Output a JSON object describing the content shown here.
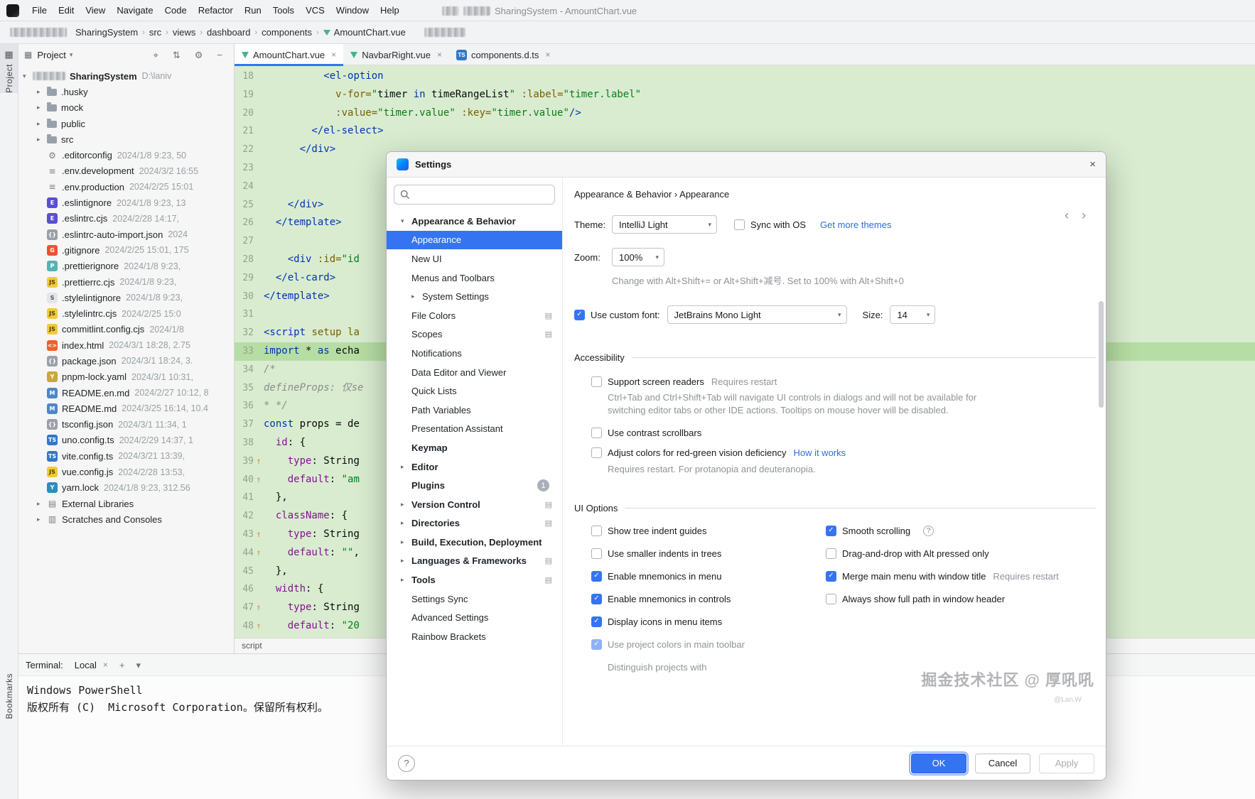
{
  "menubar": {
    "items": [
      "File",
      "Edit",
      "View",
      "Navigate",
      "Code",
      "Refactor",
      "Run",
      "Tools",
      "VCS",
      "Window",
      "Help"
    ],
    "window_title": "SharingSystem - AmountChart.vue"
  },
  "navbar": {
    "crumbs": [
      {
        "label": "SharingSystem",
        "sep": "›"
      },
      {
        "label": "src",
        "sep": "›"
      },
      {
        "label": "views",
        "sep": "›"
      },
      {
        "label": "dashboard",
        "sep": "›"
      },
      {
        "label": "components",
        "sep": "›"
      },
      {
        "label": "AmountChart.vue",
        "sep": "",
        "vue": true
      }
    ]
  },
  "stripe": {
    "project": "Project",
    "bookmarks": "Bookmarks"
  },
  "project": {
    "title": "Project",
    "root_name": "SharingSystem",
    "root_path": "D:\\laniv",
    "folders": [
      ".husky",
      "mock",
      "public",
      "src"
    ],
    "files": [
      {
        "name": ".editorconfig",
        "meta": "2024/1/8 9:23, 50",
        "icon": "⚙",
        "kind": "gear"
      },
      {
        "name": ".env.development",
        "meta": "2024/3/2 16:55",
        "icon": "≡",
        "kind": "env"
      },
      {
        "name": ".env.production",
        "meta": "2024/2/25 15:01",
        "icon": "≡",
        "kind": "env"
      },
      {
        "name": ".eslintignore",
        "meta": "2024/1/8 9:23, 13",
        "icon": "E",
        "kind": "eslint"
      },
      {
        "name": ".eslintrc.cjs",
        "meta": "2024/2/28 14:17,",
        "icon": "E",
        "kind": "eslint"
      },
      {
        "name": ".eslintrc-auto-import.json",
        "meta": "2024",
        "icon": "{}",
        "kind": "json"
      },
      {
        "name": ".gitignore",
        "meta": "2024/2/25 15:01, 175",
        "icon": "G",
        "kind": "git"
      },
      {
        "name": ".prettierignore",
        "meta": "2024/1/8 9:23,",
        "icon": "P",
        "kind": "pret"
      },
      {
        "name": ".prettierrc.cjs",
        "meta": "2024/1/8 9:23,",
        "icon": "JS",
        "kind": "js"
      },
      {
        "name": ".stylelintignore",
        "meta": "2024/1/8 9:23,",
        "icon": "S",
        "kind": "style"
      },
      {
        "name": ".stylelintrc.cjs",
        "meta": "2024/2/25 15:0",
        "icon": "JS",
        "kind": "js"
      },
      {
        "name": "commitlint.config.cjs",
        "meta": "2024/1/8",
        "icon": "JS",
        "kind": "js"
      },
      {
        "name": "index.html",
        "meta": "2024/3/1 18:28, 2.75",
        "icon": "<>",
        "kind": "html"
      },
      {
        "name": "package.json",
        "meta": "2024/3/1 18:24, 3.",
        "icon": "{}",
        "kind": "json"
      },
      {
        "name": "pnpm-lock.yaml",
        "meta": "2024/3/1 10:31,",
        "icon": "Y",
        "kind": "yaml"
      },
      {
        "name": "README.en.md",
        "meta": "2024/2/27 10:12, 8",
        "icon": "M",
        "kind": "md"
      },
      {
        "name": "README.md",
        "meta": "2024/3/25 16:14, 10.4",
        "icon": "M",
        "kind": "md"
      },
      {
        "name": "tsconfig.json",
        "meta": "2024/3/1 11:34, 1",
        "icon": "{}",
        "kind": "json"
      },
      {
        "name": "uno.config.ts",
        "meta": "2024/2/29 14:37, 1",
        "icon": "TS",
        "kind": "ts"
      },
      {
        "name": "vite.config.ts",
        "meta": "2024/3/21 13:39,",
        "icon": "TS",
        "kind": "ts"
      },
      {
        "name": "vue.config.js",
        "meta": "2024/2/28 13:53,",
        "icon": "JS",
        "kind": "js"
      },
      {
        "name": "yarn.lock",
        "meta": "2024/1/8 9:23, 312.56",
        "icon": "Y",
        "kind": "yarn"
      }
    ],
    "extras": [
      {
        "name": "External Libraries",
        "icon": "▤",
        "kind": "lib"
      },
      {
        "name": "Scratches and Consoles",
        "icon": "▥",
        "kind": "scratch"
      }
    ]
  },
  "editor": {
    "tabs": [
      {
        "label": "AmountChart.vue",
        "kind": "vue",
        "icon": "",
        "active": true
      },
      {
        "label": "NavbarRight.vue",
        "kind": "vue",
        "icon": ""
      },
      {
        "label": "components.d.ts",
        "kind": "ts",
        "icon": "TS"
      }
    ],
    "bottom_crumb": "script",
    "lines": [
      {
        "num": 18,
        "segs": [
          {
            "t": "          ",
            "c": "pl"
          },
          {
            "t": "<el-option",
            "c": "tag"
          }
        ]
      },
      {
        "num": 19,
        "segs": [
          {
            "t": "            ",
            "c": "pl"
          },
          {
            "t": "v-for=",
            "c": "dir"
          },
          {
            "t": "\"",
            "c": "str"
          },
          {
            "t": "timer ",
            "c": "var"
          },
          {
            "t": "in",
            "c": "kw"
          },
          {
            "t": " timeRangeList",
            "c": "var"
          },
          {
            "t": "\"",
            "c": "str"
          },
          {
            "t": " ",
            "c": "pl"
          },
          {
            "t": ":label=",
            "c": "dir"
          },
          {
            "t": "\"timer.label\"",
            "c": "str"
          }
        ]
      },
      {
        "num": 20,
        "segs": [
          {
            "t": "            ",
            "c": "pl"
          },
          {
            "t": ":value=",
            "c": "dir"
          },
          {
            "t": "\"timer.value\"",
            "c": "str"
          },
          {
            "t": " ",
            "c": "pl"
          },
          {
            "t": ":key=",
            "c": "dir"
          },
          {
            "t": "\"timer.value\"",
            "c": "str"
          },
          {
            "t": "/>",
            "c": "tag"
          }
        ]
      },
      {
        "num": 21,
        "segs": [
          {
            "t": "        ",
            "c": "pl"
          },
          {
            "t": "</el-select>",
            "c": "tag"
          }
        ]
      },
      {
        "num": 22,
        "segs": [
          {
            "t": "      ",
            "c": "pl"
          },
          {
            "t": "</div>",
            "c": "tag"
          }
        ]
      },
      {
        "num": 23,
        "segs": []
      },
      {
        "num": 24,
        "segs": []
      },
      {
        "num": 25,
        "segs": [
          {
            "t": "    ",
            "c": "pl"
          },
          {
            "t": "</div>",
            "c": "tag"
          }
        ]
      },
      {
        "num": 26,
        "segs": [
          {
            "t": "  ",
            "c": "pl"
          },
          {
            "t": "</template>",
            "c": "tag"
          }
        ]
      },
      {
        "num": 27,
        "segs": []
      },
      {
        "num": 28,
        "segs": [
          {
            "t": "    ",
            "c": "pl"
          },
          {
            "t": "<div",
            "c": "tag"
          },
          {
            "t": " ",
            "c": "pl"
          },
          {
            "t": ":id=",
            "c": "dir"
          },
          {
            "t": "\"id",
            "c": "str"
          }
        ]
      },
      {
        "num": 29,
        "segs": [
          {
            "t": "  ",
            "c": "pl"
          },
          {
            "t": "</el-card>",
            "c": "tag"
          }
        ]
      },
      {
        "num": 30,
        "segs": [
          {
            "t": "</template>",
            "c": "tag"
          }
        ]
      },
      {
        "num": 31,
        "segs": []
      },
      {
        "num": 32,
        "segs": [
          {
            "t": "<script ",
            "c": "tag"
          },
          {
            "t": "setup la",
            "c": "dir"
          }
        ]
      },
      {
        "num": 33,
        "hl": true,
        "segs": [
          {
            "t": "import",
            "c": "kw"
          },
          {
            "t": " * ",
            "c": "pl"
          },
          {
            "t": "as",
            "c": "kw"
          },
          {
            "t": " echa",
            "c": "pl"
          }
        ]
      },
      {
        "num": 34,
        "segs": [
          {
            "t": "/*",
            "c": "cm"
          }
        ]
      },
      {
        "num": 35,
        "segs": [
          {
            "t": "defineProps: 仅se",
            "c": "cm"
          }
        ]
      },
      {
        "num": 36,
        "segs": [
          {
            "t": "* */",
            "c": "cm"
          }
        ]
      },
      {
        "num": 37,
        "segs": [
          {
            "t": "const",
            "c": "kw"
          },
          {
            "t": " props = de",
            "c": "pl"
          }
        ]
      },
      {
        "num": 38,
        "segs": [
          {
            "t": "  ",
            "c": "pl"
          },
          {
            "t": "id",
            "c": "prop"
          },
          {
            "t": ": {",
            "c": "pl"
          }
        ]
      },
      {
        "num": 39,
        "mk": "↑",
        "segs": [
          {
            "t": "    ",
            "c": "pl"
          },
          {
            "t": "type",
            "c": "prop"
          },
          {
            "t": ": String",
            "c": "pl"
          }
        ]
      },
      {
        "num": 40,
        "mk": "↑",
        "segs": [
          {
            "t": "    ",
            "c": "pl"
          },
          {
            "t": "default",
            "c": "prop"
          },
          {
            "t": ": ",
            "c": "pl"
          },
          {
            "t": "\"am",
            "c": "str"
          }
        ]
      },
      {
        "num": 41,
        "segs": [
          {
            "t": "  },",
            "c": "pl"
          }
        ]
      },
      {
        "num": 42,
        "segs": [
          {
            "t": "  ",
            "c": "pl"
          },
          {
            "t": "className",
            "c": "prop"
          },
          {
            "t": ": {",
            "c": "pl"
          }
        ]
      },
      {
        "num": 43,
        "mk": "↑",
        "segs": [
          {
            "t": "    ",
            "c": "pl"
          },
          {
            "t": "type",
            "c": "prop"
          },
          {
            "t": ": String",
            "c": "pl"
          }
        ]
      },
      {
        "num": 44,
        "mk": "↑",
        "segs": [
          {
            "t": "    ",
            "c": "pl"
          },
          {
            "t": "default",
            "c": "prop"
          },
          {
            "t": ": ",
            "c": "pl"
          },
          {
            "t": "\"\"",
            "c": "str"
          },
          {
            "t": ",",
            "c": "pl"
          }
        ]
      },
      {
        "num": 45,
        "segs": [
          {
            "t": "  },",
            "c": "pl"
          }
        ]
      },
      {
        "num": 46,
        "segs": [
          {
            "t": "  ",
            "c": "pl"
          },
          {
            "t": "width",
            "c": "prop"
          },
          {
            "t": ": {",
            "c": "pl"
          }
        ]
      },
      {
        "num": 47,
        "mk": "↑",
        "segs": [
          {
            "t": "    ",
            "c": "pl"
          },
          {
            "t": "type",
            "c": "prop"
          },
          {
            "t": ": String",
            "c": "pl"
          }
        ]
      },
      {
        "num": 48,
        "mk": "↑",
        "segs": [
          {
            "t": "    ",
            "c": "pl"
          },
          {
            "t": "default",
            "c": "prop"
          },
          {
            "t": ": ",
            "c": "pl"
          },
          {
            "t": "\"20",
            "c": "str"
          }
        ]
      }
    ]
  },
  "terminal": {
    "title": "Terminal:",
    "tab": "Local",
    "lines": [
      "Windows PowerShell",
      "版权所有 (C)  Microsoft Corporation。保留所有权利。"
    ]
  },
  "dialog": {
    "title": "Settings",
    "search_placeholder": "",
    "header": "Appearance & Behavior  ›  Appearance",
    "theme_label": "Theme:",
    "theme_value": "IntelliJ Light",
    "sync_label": "Sync with OS",
    "themes_link": "Get more themes",
    "zoom_label": "Zoom:",
    "zoom_value": "100%",
    "zoom_hint": "Change with Alt+Shift+= or Alt+Shift+减号. Set to 100% with Alt+Shift+0",
    "font_label": "Use custom font:",
    "font_value": "JetBrains Mono Light",
    "size_label": "Size:",
    "size_value": "14",
    "acc_title": "Accessibility",
    "acc": {
      "sr_label": "Support screen readers",
      "sr_suffix": "Requires restart",
      "note": "Ctrl+Tab and Ctrl+Shift+Tab will navigate UI controls in dialogs and will not be available for switching editor tabs or other IDE actions. Tooltips on mouse hover will be disabled.",
      "contrast_label": "Use contrast scrollbars",
      "rg_label": "Adjust colors for red-green vision deficiency",
      "rg_link": "How it works",
      "rg_note": "Requires restart. For protanopia and deuteranopia."
    },
    "ui_title": "UI Options",
    "ui_left": [
      {
        "label": "Show tree indent guides"
      },
      {
        "label": "Use smaller indents in trees"
      },
      {
        "label": "Enable mnemonics in menu",
        "checked": true,
        "tick": "✓"
      },
      {
        "label": "Enable mnemonics in controls",
        "checked": true,
        "tick": "✓"
      },
      {
        "label": "Display icons in menu items",
        "checked": true,
        "tick": "✓"
      },
      {
        "label": "Use project colors in main toolbar",
        "checked": true,
        "tick": "✓",
        "disabled": true
      },
      {
        "label": "Distinguish projects with",
        "textOnly": true,
        "disabled": true
      }
    ],
    "ui_right": [
      {
        "label": "Smooth scrolling",
        "checked": true,
        "tick": "✓",
        "help": true
      },
      {
        "label": "Drag-and-drop with Alt pressed only"
      },
      {
        "label": "Merge main menu with window title",
        "checked": true,
        "tick": "✓",
        "suffix": "Requires restart"
      },
      {
        "label": "Always show full path in window header"
      }
    ],
    "tree": [
      {
        "label": "Appearance & Behavior",
        "bold": true,
        "chev": "▾"
      },
      {
        "label": "Appearance",
        "selected": true,
        "chev": ""
      },
      {
        "label": "New UI",
        "chev": ""
      },
      {
        "label": "Menus and Toolbars",
        "chev": ""
      },
      {
        "label": "System Settings",
        "chev": "▸",
        "child": true
      },
      {
        "label": "File Colors",
        "chev": "",
        "ricon": true
      },
      {
        "label": "Scopes",
        "chev": "",
        "ricon": true
      },
      {
        "label": "Notifications",
        "chev": ""
      },
      {
        "label": "Data Editor and Viewer",
        "chev": ""
      },
      {
        "label": "Quick Lists",
        "chev": ""
      },
      {
        "label": "Path Variables",
        "chev": ""
      },
      {
        "label": "Presentation Assistant",
        "chev": ""
      },
      {
        "label": "Keymap",
        "bold": true,
        "chev": ""
      },
      {
        "label": "Editor",
        "bold": true,
        "chev": "▸"
      },
      {
        "label": "Plugins",
        "bold": true,
        "chev": "",
        "badge": "1"
      },
      {
        "label": "Version Control",
        "bold": true,
        "chev": "▸",
        "ricon": true
      },
      {
        "label": "Directories",
        "bold": true,
        "chev": "▸",
        "ricon": true
      },
      {
        "label": "Build, Execution, Deployment",
        "bold": true,
        "chev": "▸"
      },
      {
        "label": "Languages & Frameworks",
        "bold": true,
        "chev": "▸",
        "ricon": true
      },
      {
        "label": "Tools",
        "bold": true,
        "chev": "▸",
        "ricon": true
      },
      {
        "label": "Settings Sync",
        "chev": ""
      },
      {
        "label": "Advanced Settings",
        "chev": ""
      },
      {
        "label": "Rainbow Brackets",
        "chev": ""
      }
    ],
    "ok": "OK",
    "cancel": "Cancel",
    "apply": "Apply",
    "help_glyph": "?"
  },
  "watermark": {
    "main": "掘金技术社区 @ 厚吼吼",
    "sub": "@Lan.W"
  },
  "icons": {
    "close": "×",
    "down_sm": "▾",
    "expanded": "▾",
    "collapsed": "▸",
    "grid": "▤",
    "back": "‹",
    "forward": "›",
    "check": "✓",
    "q": "?",
    "locate": "⌖",
    "collapse": "⇅",
    "gear": "⚙",
    "minus": "−",
    "plus": "+",
    "panel": "▦"
  }
}
